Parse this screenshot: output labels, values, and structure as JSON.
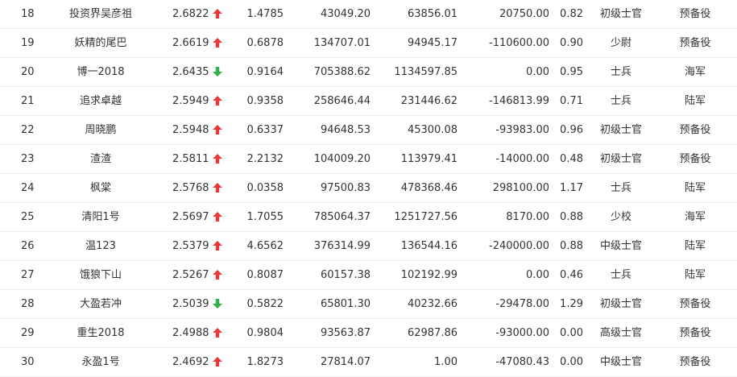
{
  "colors": {
    "up": "#e83a3a",
    "down": "#2fb344",
    "text": "#333333",
    "border": "#eeeeee"
  },
  "rows": [
    {
      "rank": "18",
      "name": "投资界吴彦祖",
      "score": "2.6822",
      "trend": "up",
      "ratio": "1.4785",
      "v1": "43049.20",
      "v2": "63856.01",
      "v3": "20750.00",
      "v4": "0.82",
      "level": "初级士官",
      "branch": "预备役"
    },
    {
      "rank": "19",
      "name": "妖精的尾巴",
      "score": "2.6619",
      "trend": "up",
      "ratio": "0.6878",
      "v1": "134707.01",
      "v2": "94945.17",
      "v3": "-110600.00",
      "v4": "0.90",
      "level": "少尉",
      "branch": "预备役"
    },
    {
      "rank": "20",
      "name": "博一2018",
      "score": "2.6435",
      "trend": "down",
      "ratio": "0.9164",
      "v1": "705388.62",
      "v2": "1134597.85",
      "v3": "0.00",
      "v4": "0.95",
      "level": "士兵",
      "branch": "海军"
    },
    {
      "rank": "21",
      "name": "追求卓越",
      "score": "2.5949",
      "trend": "up",
      "ratio": "0.9358",
      "v1": "258646.44",
      "v2": "231446.62",
      "v3": "-146813.99",
      "v4": "0.71",
      "level": "士兵",
      "branch": "陆军"
    },
    {
      "rank": "22",
      "name": "周晓鹏",
      "score": "2.5948",
      "trend": "up",
      "ratio": "0.6337",
      "v1": "94648.53",
      "v2": "45300.08",
      "v3": "-93983.00",
      "v4": "0.96",
      "level": "初级士官",
      "branch": "预备役"
    },
    {
      "rank": "23",
      "name": "渣渣",
      "score": "2.5811",
      "trend": "up",
      "ratio": "2.2132",
      "v1": "104009.20",
      "v2": "113979.41",
      "v3": "-14000.00",
      "v4": "0.48",
      "level": "初级士官",
      "branch": "预备役"
    },
    {
      "rank": "24",
      "name": "枫棠",
      "score": "2.5768",
      "trend": "up",
      "ratio": "0.0358",
      "v1": "97500.83",
      "v2": "478368.46",
      "v3": "298100.00",
      "v4": "1.17",
      "level": "士兵",
      "branch": "陆军"
    },
    {
      "rank": "25",
      "name": "清阳1号",
      "score": "2.5697",
      "trend": "up",
      "ratio": "1.7055",
      "v1": "785064.37",
      "v2": "1251727.56",
      "v3": "8170.00",
      "v4": "0.88",
      "level": "少校",
      "branch": "海军"
    },
    {
      "rank": "26",
      "name": "温123",
      "score": "2.5379",
      "trend": "up",
      "ratio": "4.6562",
      "v1": "376314.99",
      "v2": "136544.16",
      "v3": "-240000.00",
      "v4": "0.88",
      "level": "中级士官",
      "branch": "陆军"
    },
    {
      "rank": "27",
      "name": "饿狼下山",
      "score": "2.5267",
      "trend": "up",
      "ratio": "0.8087",
      "v1": "60157.38",
      "v2": "102192.99",
      "v3": "0.00",
      "v4": "0.46",
      "level": "士兵",
      "branch": "陆军"
    },
    {
      "rank": "28",
      "name": "大盈若冲",
      "score": "2.5039",
      "trend": "down",
      "ratio": "0.5822",
      "v1": "65801.30",
      "v2": "40232.66",
      "v3": "-29478.00",
      "v4": "1.29",
      "level": "初级士官",
      "branch": "预备役"
    },
    {
      "rank": "29",
      "name": "重生2018",
      "score": "2.4988",
      "trend": "up",
      "ratio": "0.9804",
      "v1": "93563.87",
      "v2": "62987.86",
      "v3": "-93000.00",
      "v4": "0.00",
      "level": "高级士官",
      "branch": "预备役"
    },
    {
      "rank": "30",
      "name": "永盈1号",
      "score": "2.4692",
      "trend": "up",
      "ratio": "1.8273",
      "v1": "27814.07",
      "v2": "1.00",
      "v3": "-47080.43",
      "v4": "0.00",
      "level": "中级士官",
      "branch": "预备役"
    }
  ]
}
